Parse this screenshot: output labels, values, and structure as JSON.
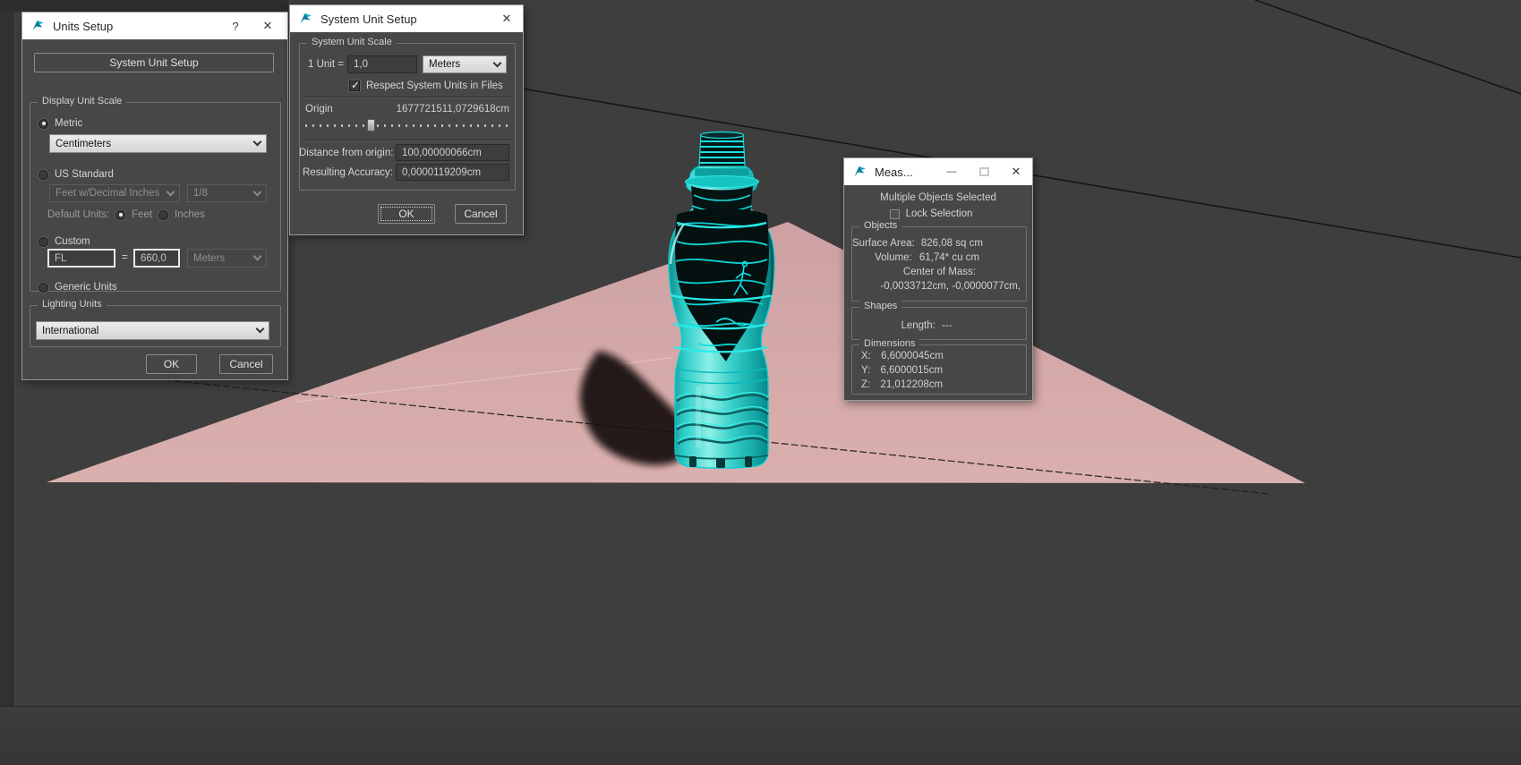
{
  "scene": {
    "viewport_bg": "#3e3e3e",
    "ground_plane_color": "#d2a5a5",
    "selection_color": "#00e6e6",
    "object_name": "bottle"
  },
  "icons": {
    "help": "?",
    "close": "✕",
    "minimize": "—"
  },
  "buttons": {
    "ok": "OK",
    "cancel": "Cancel"
  },
  "units_setup": {
    "title": "Units Setup",
    "system_unit_setup_button": "System Unit Setup",
    "display_unit_scale": {
      "label": "Display Unit Scale",
      "metric": "Metric",
      "metric_value": "Centimeters",
      "us_standard": "US Standard",
      "us_standard_value": "Feet w/Decimal Inches",
      "us_fraction": "1/8",
      "default_units": "Default Units:",
      "feet": "Feet",
      "inches": "Inches",
      "custom": "Custom",
      "custom_name": "FL",
      "equals": "=",
      "custom_value": "660,0",
      "custom_unit": "Meters",
      "generic": "Generic Units"
    },
    "lighting_units": {
      "label": "Lighting Units",
      "value": "International"
    }
  },
  "system_unit_setup": {
    "title": "System Unit Setup",
    "group_label": "System Unit Scale",
    "unit_label": "1 Unit =",
    "unit_value": "1,0",
    "unit_choice": "Meters",
    "respect_checkbox": "Respect System Units in Files",
    "origin_label": "Origin",
    "origin_value": "1677721511,0729618cm",
    "distance_label": "Distance from origin:",
    "distance_value": "100,00000066cm",
    "accuracy_label": "Resulting Accuracy:",
    "accuracy_value": "0,0000119209cm"
  },
  "measure": {
    "title": "Meas...",
    "status": "Multiple Objects Selected",
    "lock_selection": "Lock Selection",
    "objects": {
      "label": "Objects",
      "surface_area_label": "Surface Area:",
      "surface_area_value": "826,08 sq cm",
      "volume_label": "Volume:",
      "volume_value": "61,74* cu cm",
      "center_of_mass_label": "Center of Mass:",
      "center_of_mass_value": "-0,0033712cm, -0,0000077cm,"
    },
    "shapes": {
      "label": "Shapes",
      "length_label": "Length:",
      "length_value": "---"
    },
    "dimensions": {
      "label": "Dimensions",
      "x_label": "X:",
      "x_value": "6,6000045cm",
      "y_label": "Y:",
      "y_value": "6,6000015cm",
      "z_label": "Z:",
      "z_value": "21,012208cm"
    }
  }
}
